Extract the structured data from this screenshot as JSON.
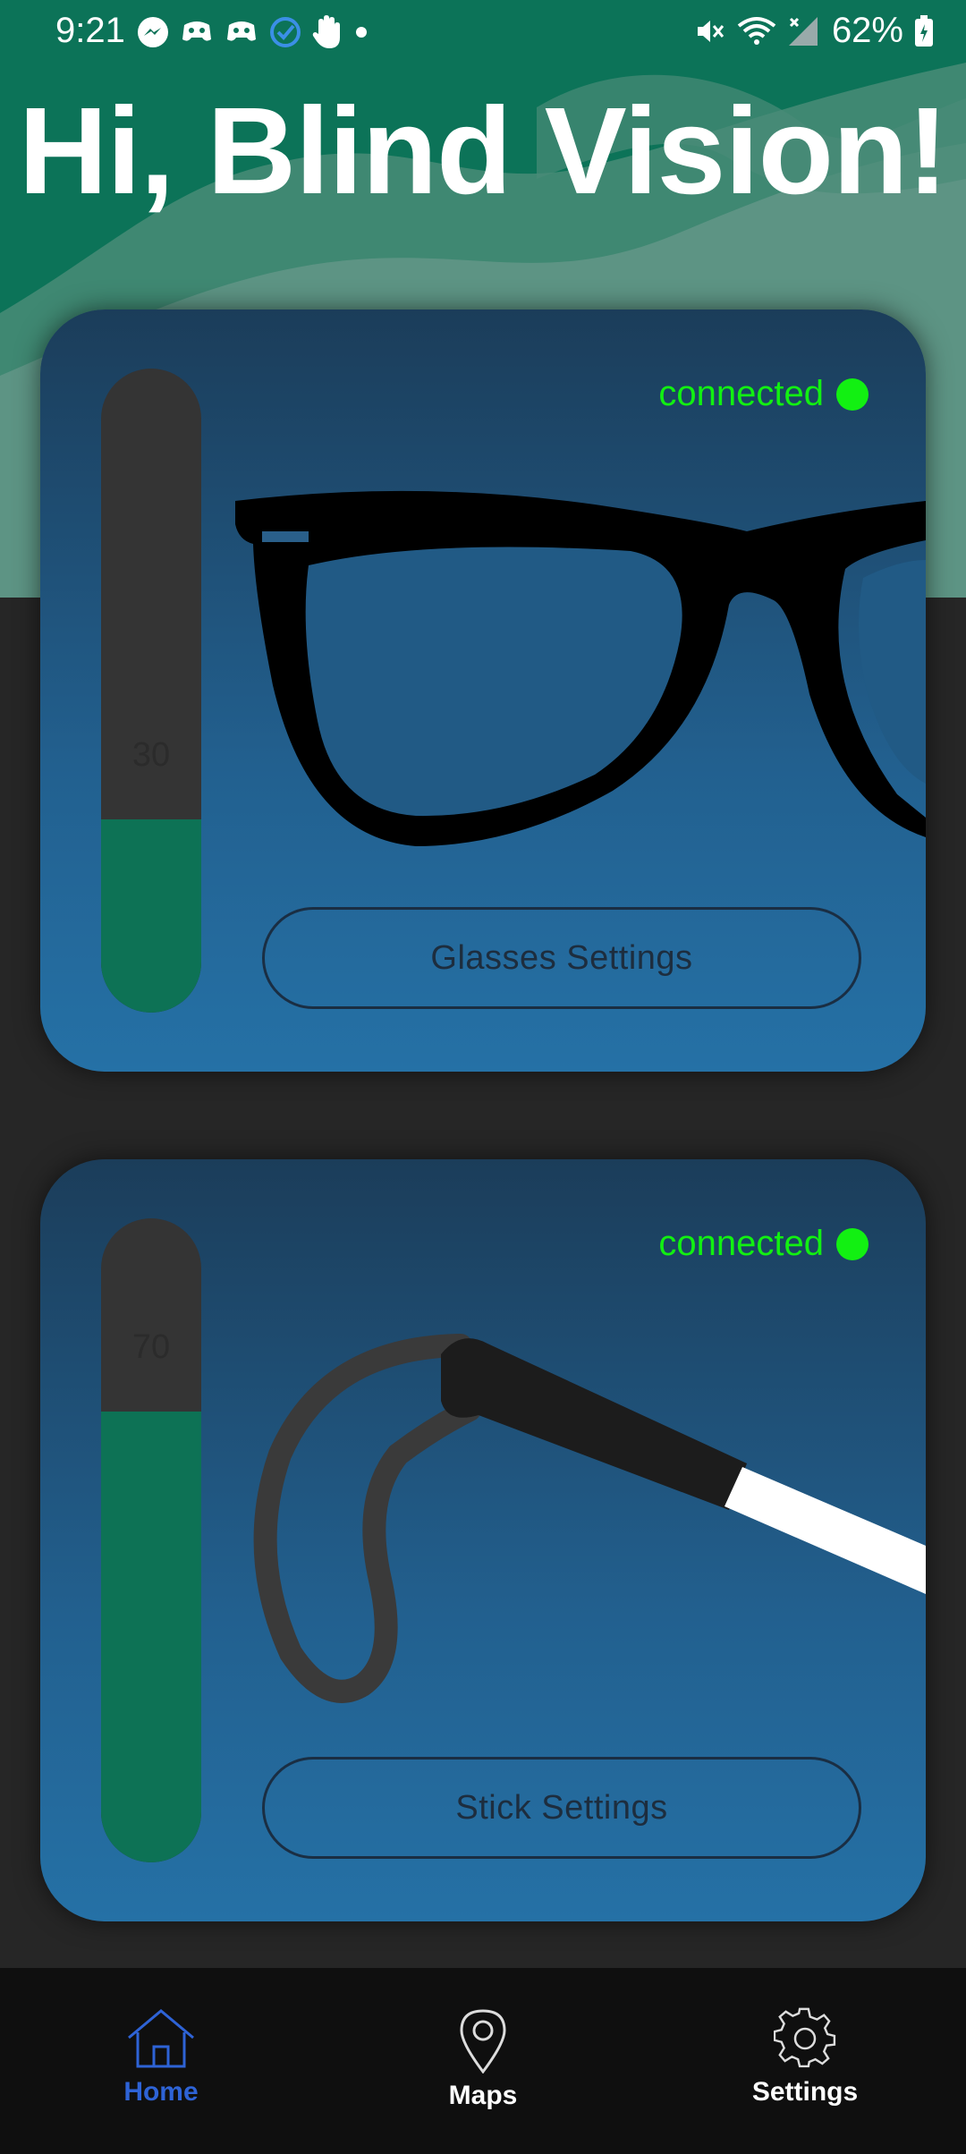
{
  "status_bar": {
    "time": "9:21",
    "battery_percent": "62%",
    "left_icons": [
      "messenger-icon",
      "game-icon",
      "game-icon",
      "check-icon",
      "hand-icon",
      "dot-icon"
    ],
    "right_icons": [
      "mute-icon",
      "wifi-icon",
      "no-signal-icon",
      "battery-icon"
    ]
  },
  "header": {
    "greeting": "Hi, Blind Vision!"
  },
  "devices": [
    {
      "status": "connected",
      "battery": "30",
      "battery_level": 30,
      "button_label": "Glasses Settings",
      "image": "glasses"
    },
    {
      "status": "connected",
      "battery": "70",
      "battery_level": 70,
      "button_label": "Stick Settings",
      "image": "white-cane"
    }
  ],
  "nav": [
    {
      "label": "Home",
      "icon": "home-icon",
      "active": true
    },
    {
      "label": "Maps",
      "icon": "map-pin-icon",
      "active": false
    },
    {
      "label": "Settings",
      "icon": "gear-icon",
      "active": false
    }
  ],
  "colors": {
    "connected": "#12f012",
    "accent": "#2e63d6",
    "battery_fill": "#0d7255",
    "header_bg": "#0c7358"
  }
}
